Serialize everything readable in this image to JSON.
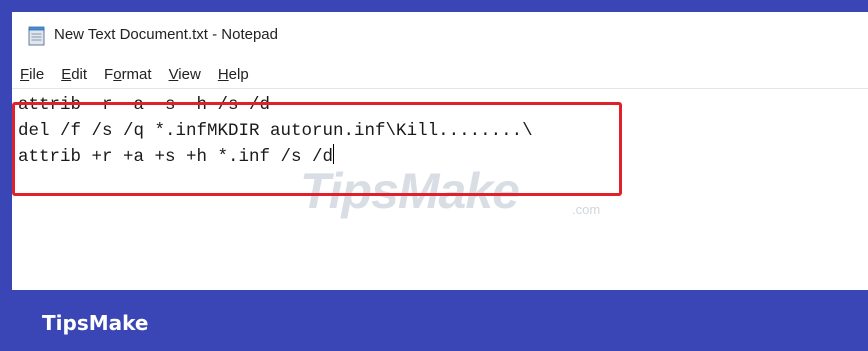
{
  "window": {
    "title": "New Text Document.txt - Notepad"
  },
  "menu": [
    {
      "accel": "F",
      "rest": "ile"
    },
    {
      "accel": "E",
      "rest": "dit"
    },
    {
      "pre": "F",
      "accel": "o",
      "rest": "rmat"
    },
    {
      "accel": "V",
      "rest": "iew"
    },
    {
      "accel": "H",
      "rest": "elp"
    }
  ],
  "editor": {
    "lines": [
      "attrib -r -a -s -h /s /d",
      "del /f /s /q *.infMKDIR autorun.inf\\Kill........\\",
      "attrib +r +a +s +h *.inf /s /d"
    ]
  },
  "watermark": {
    "text": "TipsMake",
    "suffix": ".com"
  },
  "footer": {
    "brand": "TipsMake"
  },
  "colors": {
    "background": "#3a46b5",
    "highlight": "#e0202a"
  },
  "icons": {
    "app": "notepad-icon"
  }
}
